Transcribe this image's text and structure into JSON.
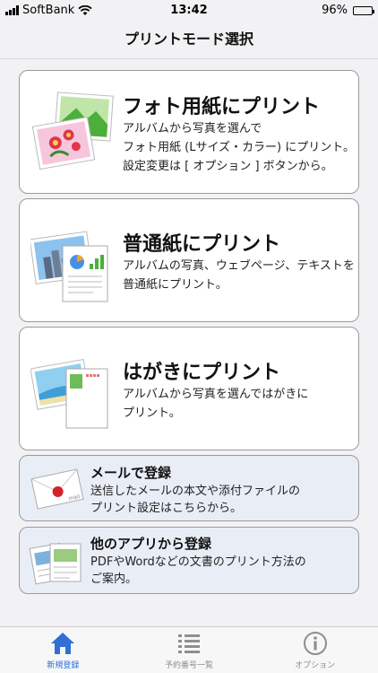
{
  "status_bar": {
    "carrier": "SoftBank",
    "time": "13:42",
    "battery_percent": "96%",
    "battery_level": 0.96
  },
  "nav": {
    "title": "プリントモード選択"
  },
  "cards": {
    "photo": {
      "title": "フォト用紙にプリント",
      "description": "アルバムから写真を選んで\nフォト用紙 (Lサイズ・カラー) にプリント。\n設定変更は [ オプション ] ボタンから。"
    },
    "plain": {
      "title": "普通紙にプリント",
      "description": "アルバムの写真、ウェブページ、テキストを\n普通紙にプリント。"
    },
    "postcard": {
      "title": "はがきにプリント",
      "description": "アルバムから写真を選んではがきに\nプリント。"
    },
    "mail": {
      "title": "メールで登録",
      "description": "送信したメールの本文や添付ファイルの\nプリント設定はこちらから。",
      "icon_text": "mail"
    },
    "other_app": {
      "title": "他のアプリから登録",
      "description": "PDFやWordなどの文書のプリント方法の\nご案内。"
    }
  },
  "tab_bar": {
    "tabs": [
      {
        "label": "新規登録",
        "icon": "home-icon",
        "active": true
      },
      {
        "label": "予約番号一覧",
        "icon": "list-icon",
        "active": false
      },
      {
        "label": "オプション",
        "icon": "info-icon",
        "active": false
      }
    ]
  },
  "colors": {
    "accent": "#2f6fd6",
    "small_card_bg": "#e9eef6"
  }
}
